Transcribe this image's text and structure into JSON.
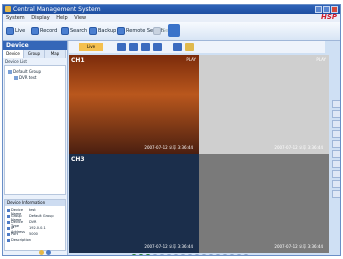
{
  "app": {
    "title": "Central Management System",
    "brand": "HSP"
  },
  "menu": [
    "System",
    "Display",
    "Help",
    "View"
  ],
  "toolbar": [
    "Live",
    "Record",
    "Search",
    "Backup",
    "Remote Search",
    "Setup"
  ],
  "left_panel": {
    "title": "Device",
    "tabs": [
      "Device",
      "Group",
      "Map"
    ],
    "list_label": "Device List",
    "tree": [
      "Default Group",
      "DVR test"
    ],
    "device_info": {
      "title": "Device Information",
      "rows": [
        {
          "k": "Device Name",
          "v": "test"
        },
        {
          "k": "Group Name",
          "v": "Default Group"
        },
        {
          "k": "Device Type",
          "v": "DVR"
        },
        {
          "k": "IP Address",
          "v": "192.0.0.1"
        },
        {
          "k": "Port",
          "v": "5000"
        },
        {
          "k": "Description",
          "v": ""
        }
      ]
    }
  },
  "video": {
    "tab": "Live",
    "channels": [
      {
        "label": "CH1",
        "status": "PLAY",
        "timestamp": "2007-07-12 오후 3:36:44"
      },
      {
        "label": "",
        "status": "PLAY",
        "timestamp": "2007-07-12 오후 3:36:44"
      },
      {
        "label": "CH3",
        "status": "",
        "timestamp": "2007-07-12 오후 3:36:44"
      },
      {
        "label": "",
        "status": "",
        "timestamp": "2007-07-12 오후 3:36:44"
      }
    ]
  },
  "pager": {
    "count": 17,
    "active": [
      0,
      1,
      2
    ]
  }
}
